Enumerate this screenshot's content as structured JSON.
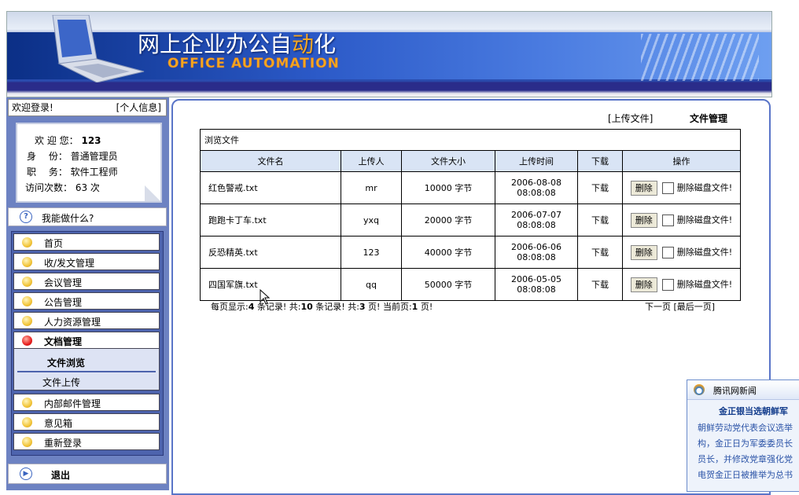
{
  "banner": {
    "title_a": "网上企业办公自",
    "title_hl": "动",
    "title_b": "化",
    "subtitle": "OFFICE AUTOMATION"
  },
  "sidebar": {
    "welcome": "欢迎登录!",
    "profile_link": "[个人信息]",
    "user": {
      "name_label": "欢 迎 您：",
      "name": "123",
      "role_label": "身　 份：",
      "role": "普通管理员",
      "job_label": "职　 务：",
      "job": "软件工程师",
      "visits_label": "访问次数：",
      "visits": "63 次"
    },
    "help": "我能做什么?",
    "menu": [
      {
        "label": "首页"
      },
      {
        "label": "收/发文管理"
      },
      {
        "label": "会议管理"
      },
      {
        "label": "公告管理"
      },
      {
        "label": "人力资源管理"
      },
      {
        "label": "文档管理"
      }
    ],
    "submenu": {
      "browse": "文件浏览",
      "upload": "文件上传"
    },
    "menu2": [
      {
        "label": "内部邮件管理"
      },
      {
        "label": "意见箱"
      },
      {
        "label": "重新登录"
      }
    ],
    "logout": "退出"
  },
  "main": {
    "upload_link": "[上传文件]",
    "section": "文件管理",
    "table_caption": "浏览文件",
    "columns": [
      "文件名",
      "上传人",
      "文件大小",
      "上传时间",
      "下载",
      "操作"
    ],
    "rows": [
      {
        "name": "红色警戒.txt",
        "uploader": "mr",
        "size": "10000 字节",
        "date": "2006-08-08",
        "time": "08:08:08",
        "download": "下载"
      },
      {
        "name": "跑跑卡丁车.txt",
        "uploader": "yxq",
        "size": "20000 字节",
        "date": "2006-07-07",
        "time": "08:08:08",
        "download": "下载"
      },
      {
        "name": "反恐精英.txt",
        "uploader": "123",
        "size": "40000 字节",
        "date": "2006-06-06",
        "time": "08:08:08",
        "download": "下载"
      },
      {
        "name": "四国军旗.txt",
        "uploader": "qq",
        "size": "50000 字节",
        "date": "2006-05-05",
        "time": "08:08:08",
        "download": "下载"
      }
    ],
    "delete_btn": "删除",
    "delete_disk": "删除磁盘文件!",
    "pager": {
      "p1": "每页显示:",
      "per_page": "4",
      "p2": " 条记录! 共:",
      "total": "10",
      "p3": " 条记录! 共:",
      "pages": "3",
      "p4": " 页! 当前页:",
      "current": "1",
      "p5": " 页!",
      "next": "下一页",
      "last": "[最后一页]"
    }
  },
  "news": {
    "source": "腾讯网新闻",
    "headline": "金正银当选朝鲜军",
    "lines": [
      "朝鲜劳动党代表会议选举",
      "构，金正日为军委委员长",
      "员长，并修改党章强化党",
      "电贺金正日被推举为总书"
    ]
  },
  "colors": {
    "menu_bg": "#4d63ad",
    "header_th": "#d9e4f5",
    "accent": "#5a75c8"
  }
}
